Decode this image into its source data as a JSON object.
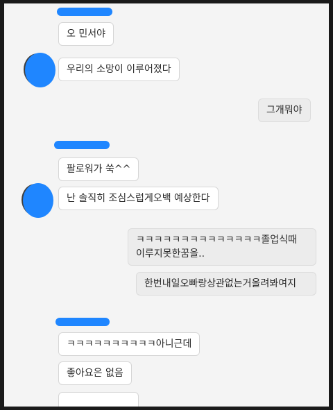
{
  "redaction_color": "#1f86ff",
  "conversation": [
    {
      "sender": "other",
      "text": "오 민서야"
    },
    {
      "sender": "other",
      "text": "우리의 소망이 이루어졌다"
    },
    {
      "sender": "me",
      "text": "그개뭐야"
    },
    {
      "sender": "other",
      "text": "팔로워가 쑥^^"
    },
    {
      "sender": "other",
      "text": "난 솔직히 조심스럽게오백 예상한다"
    },
    {
      "sender": "me",
      "text_lines": [
        "ㅋㅋㅋㅋㅋㅋㅋㅋㅋㅋㅋㅋㅋㅋ졸업식때",
        "이루지못한꿈을.."
      ]
    },
    {
      "sender": "me",
      "text": "한번내일오빠랑상관없는거올려봐여지"
    },
    {
      "sender": "other",
      "text": "ㅋㅋㅋㅋㅋㅋㅋㅋㅋㅋ아니근데"
    },
    {
      "sender": "other",
      "text": "좋아요은 없음"
    }
  ]
}
